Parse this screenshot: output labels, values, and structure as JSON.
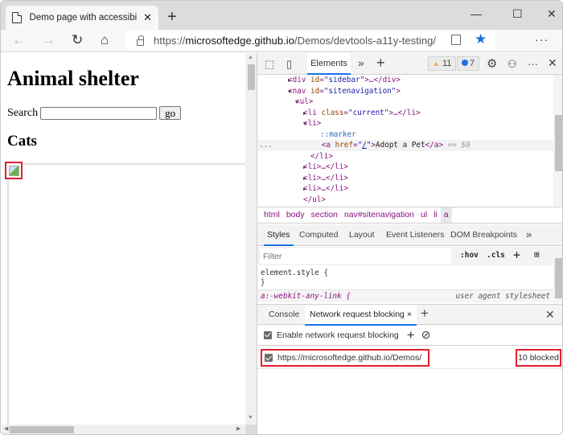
{
  "browser": {
    "tab_title": "Demo page with accessibility issues",
    "new_tab_label": "+",
    "window_controls": {
      "minimize": "—",
      "maximize": "☐",
      "close": "✕"
    },
    "nav": {
      "back": "←",
      "forward": "→",
      "refresh": "↻",
      "home": "⌂"
    },
    "url_prefix": "https://",
    "url_host": "microsoftedge.github.io",
    "url_path": "/Demos/devtools-a11y-testing/",
    "more_label": "···"
  },
  "page": {
    "heading": "Animal shelter",
    "search_label": "Search",
    "search_value": "",
    "go_label": "go",
    "subheading": "Cats"
  },
  "devtools": {
    "toolbar": {
      "elements_tab": "Elements",
      "more_tabs": "»",
      "add_tab": "+",
      "warnings_count": "11",
      "info_count": "7",
      "more": "···",
      "close": "✕"
    },
    "dom": {
      "lines": [
        {
          "indent": 3,
          "caret": "▶",
          "html": "<div id=\"sidebar\">…</div>"
        },
        {
          "indent": 3,
          "caret": "▼",
          "html": "<nav id=\"sitenavigation\">"
        },
        {
          "indent": 4,
          "caret": "▼",
          "html": "<ul>"
        },
        {
          "indent": 5,
          "caret": "▶",
          "html": "<li class=\"current\">…</li>"
        },
        {
          "indent": 5,
          "caret": "▼",
          "html": "<li>"
        },
        {
          "indent": 6,
          "caret": "",
          "html": "::marker"
        },
        {
          "indent": 6,
          "caret": "",
          "html": "<a href=\"/\">Adopt a Pet</a>"
        },
        {
          "indent": 5,
          "caret": "",
          "html": "</li>"
        },
        {
          "indent": 5,
          "caret": "▶",
          "html": "<li>…</li>"
        },
        {
          "indent": 5,
          "caret": "▶",
          "html": "<li>…</li>"
        },
        {
          "indent": 5,
          "caret": "▶",
          "html": "<li>…</li>"
        },
        {
          "indent": 4,
          "caret": "",
          "html": "</ul>"
        }
      ],
      "selected_suffix": "== $0",
      "gutter_dots": "..."
    },
    "breadcrumbs": [
      "html",
      "body",
      "section",
      "nav#sitenavigation",
      "ul",
      "li",
      "a"
    ],
    "styles_tabs": [
      "Styles",
      "Computed",
      "Layout",
      "Event Listeners",
      "DOM Breakpoints",
      "»"
    ],
    "filter_placeholder": "Filter",
    "hov_label": ":hov",
    "cls_label": ".cls",
    "styles": {
      "element_style_open": "element.style {",
      "element_style_close": "}",
      "rule_selector": "a:-webkit-any-link {",
      "rule_source": "user agent stylesheet"
    },
    "drawer": {
      "tabs": [
        "Console",
        "Network request blocking"
      ],
      "tab_close": "×",
      "add": "+",
      "close": "✕",
      "enable_label": "Enable network request blocking",
      "enable_checked": true,
      "patterns": [
        {
          "url": "https://microsoftedge.github.io/Demos/",
          "checked": true,
          "status": "10 blocked"
        }
      ]
    }
  }
}
